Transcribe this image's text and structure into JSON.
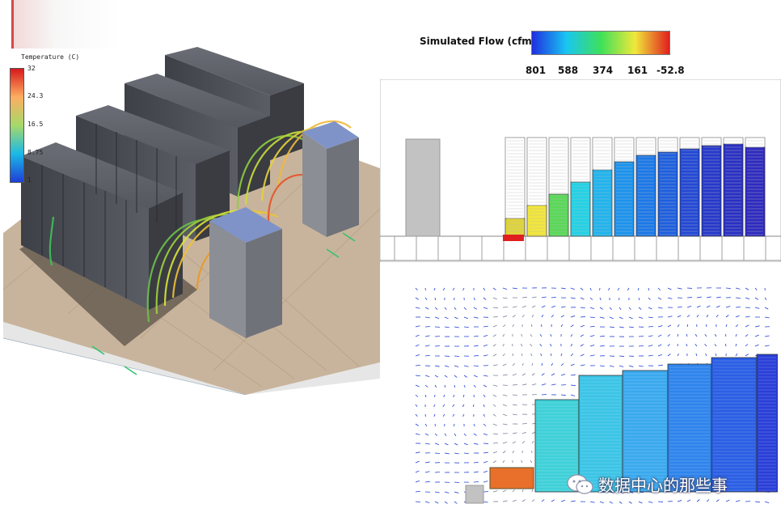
{
  "temperature_legend": {
    "title": "Temperature (C)",
    "ticks": [
      "32",
      "24.3",
      "16.5",
      "8.75",
      "1"
    ],
    "colors": [
      "#d7191c",
      "#fdae61",
      "#a6d96a",
      "#1ab9e6",
      "#1f3fd6"
    ]
  },
  "flow_legend": {
    "title": "Simulated Flow (cfm)",
    "ticks": [
      "801",
      "588",
      "374",
      "161",
      "-52.8"
    ],
    "colors": [
      "#1f2fe0",
      "#19c6f2",
      "#3de05a",
      "#f0e83a",
      "#e01f1f"
    ]
  },
  "watermark": {
    "text": "数据中心的那些事",
    "icon": "wechat-icon"
  },
  "colors": {
    "rack_dark": "#4c4f57",
    "rack_grey": "#c2c2c2",
    "floor": "#c9b59d"
  }
}
